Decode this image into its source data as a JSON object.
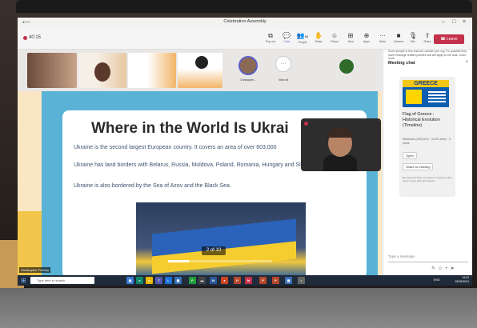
{
  "window": {
    "title": "Celebration Assembly"
  },
  "toolbar": {
    "timer": "40:15",
    "buttons": [
      {
        "icon": "pop-out-icon",
        "label": "Pop out"
      },
      {
        "icon": "chat-icon",
        "label": "Chat"
      },
      {
        "icon": "people-icon",
        "label": "People",
        "count": "68"
      },
      {
        "icon": "raise-hand-icon",
        "label": "Raise"
      },
      {
        "icon": "react-icon",
        "label": "React"
      },
      {
        "icon": "view-icon",
        "label": "View"
      },
      {
        "icon": "apps-icon",
        "label": "Apps"
      },
      {
        "icon": "more-icon",
        "label": "More"
      },
      {
        "icon": "camera-icon",
        "label": "Camera"
      },
      {
        "icon": "mic-icon",
        "label": "Mic"
      },
      {
        "icon": "share-icon",
        "label": "Share"
      }
    ],
    "leave_label": "Leave"
  },
  "strip": {
    "participant_name": "Christophe...",
    "view_all": "View all"
  },
  "chat": {
    "note": "Some people in this chat are outside your org. It's possible they have message related policies that will apply to the chat. Learn more",
    "title": "Meeting chat",
    "card": {
      "banner": "GREECE",
      "title": "Flag of Greece : Historical Evolution (Timeline)",
      "meta": "Reflowers (G35,4K0) · 44.9K views · 3 years",
      "open_label": "Open",
      "share_label": "Share to meeting",
      "footer": "By using YouTube, you agree to privacy policy, terms of use, and permissions."
    },
    "input_placeholder": "Type a message"
  },
  "slide": {
    "title": "Where in the World Is Ukrai",
    "p1": "Ukraine is the second largest European country. It covers an area of over 603,000",
    "p2": "Ukraine has land borders with Belarus, Russia, Moldova, Poland, Romania, Hungary and Slovakia.",
    "p3": "Ukraine is also bordered by the Sea of Azov and the Black Sea.",
    "counter": "2 of 10",
    "progress_fraction": 0.2
  },
  "presenter_tag": "Christopher Feeney",
  "taskbar": {
    "search_placeholder": "Type here to search",
    "lang": "ENG",
    "time": "14:02",
    "date": "18/05/2024"
  },
  "colors": {
    "accent": "#5b5fc7",
    "leave": "#c4314b",
    "slide_bg": "#5ab2d6"
  }
}
